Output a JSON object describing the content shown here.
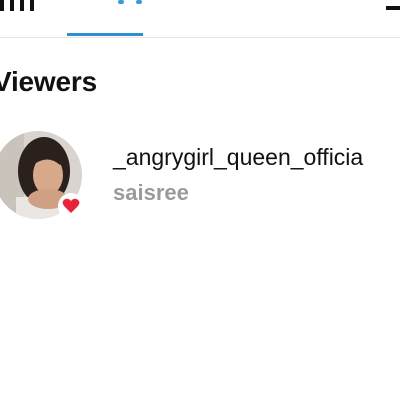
{
  "header": {
    "tabs": [
      {
        "icon": "bar-chart-icon",
        "active": false
      },
      {
        "icon": "eye-icon",
        "active": true
      }
    ],
    "more_icon": "minus-icon",
    "accent_color": "#2d8fcf"
  },
  "section": {
    "title": "Viewers"
  },
  "viewers": [
    {
      "username": "_angrygirl_queen_officia",
      "full_name": "saisree",
      "avatar": "profile-photo",
      "reaction_icon": "heart-icon",
      "reaction_color": "#e8243c"
    }
  ]
}
